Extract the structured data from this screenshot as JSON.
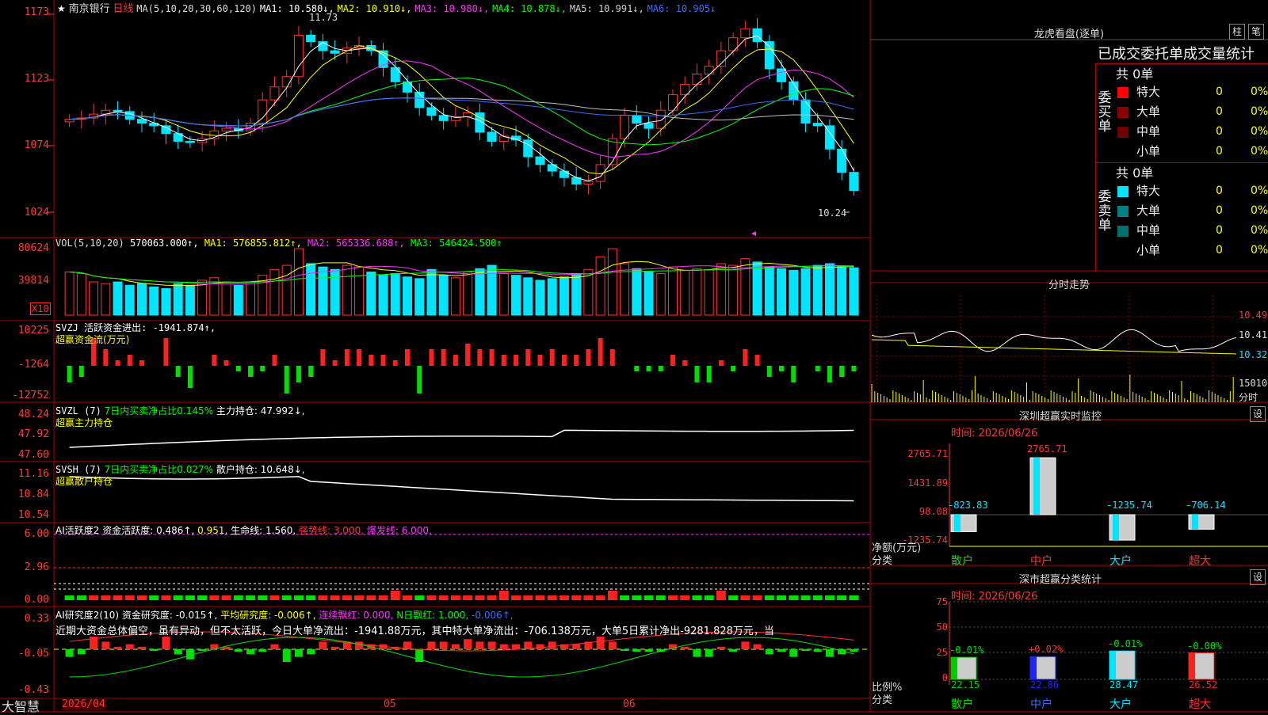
{
  "colors": {
    "up": "#ff3333",
    "down": "#00e5ff",
    "ma1": "#ffffff",
    "ma2": "#ffff00",
    "ma3": "#ff00ff",
    "ma4": "#00ff00",
    "ma5": "#c0c0c0",
    "ma6": "#3a6cff",
    "green": "#00e000",
    "yellow": "#ffff00",
    "magenta": "#ff33ff",
    "grid": "#a00000"
  },
  "header": {
    "star": "★",
    "stock_name": "南京银行",
    "period": "日线",
    "ma_label": "MA(5,10,20,30,60,120)",
    "ma1": "MA1: 10.580↓,",
    "ma2": "MA2: 10.910↓,",
    "ma3": "MA3: 10.980↓,",
    "ma4": "MA4: 10.878↓,",
    "ma5": "MA5: 10.991↓,",
    "ma6": "MA6: 10.905↓"
  },
  "main": {
    "yticks": [
      "1173",
      "1123",
      "1074",
      "1024"
    ],
    "high_label": "11.73",
    "low_label": "10.24"
  },
  "vol": {
    "label": "VOL(5,10,20)",
    "value": "570063.000↑,",
    "ma1": "MA1: 576855.812↑,",
    "ma2": "MA2: 565336.688↑,",
    "ma3": "MA3: 546424.500↑",
    "yticks": [
      "80624",
      "39814"
    ],
    "unit": "X10"
  },
  "svzj": {
    "label": "SVZJ  活跃资金进出: -1941.874↑,",
    "sub": "超赢资金流(万元)",
    "yticks": [
      "10225",
      "-1264",
      "-12752"
    ]
  },
  "svzl": {
    "label": "SVZL (7)",
    "ratio": "7日内买卖净占比0.145%",
    "main": "主力持仓: 47.992↓,",
    "sub": "超赢主力持仓",
    "yticks": [
      "48.24",
      "47.92",
      "47.60"
    ]
  },
  "svsh": {
    "label": "SVSH (7)",
    "ratio": "7日内买卖净占比0.027%",
    "main": "散户持仓: 10.648↓,",
    "sub": "超赢散户持仓",
    "yticks": [
      "11.16",
      "10.84",
      "10.54"
    ]
  },
  "ai1": {
    "label": "AI活跃度2",
    "act": "资金活跃度: 0.486↑,",
    "v2": "0.951,",
    "life": "生命线: 1.560,",
    "strong": "强势线: 3.000,",
    "burst": "爆发线: 6.000,",
    "yticks": [
      "6.00",
      "2.96",
      "0.00"
    ]
  },
  "ai2": {
    "label": "AI研究度2(10)",
    "res": "资金研究度: -0.015↑,",
    "avg": "平均研究度: -0.006↑,",
    "cont": "连续飘红: 0.000,",
    "nday": "N日飘红: 1.000,",
    "last": "-0.006↑,",
    "text": "近期大资金总体偏空，虽有异动，但不太活跃，今日大单净流出：-1941.88万元，其中特大单净流出：-706.138万元，大单5日累计净出-9281.828万元，当",
    "yticks": [
      "0.33",
      "-0.05",
      "-0.43"
    ]
  },
  "footer": {
    "brand": "大智慧",
    "date": "2026/04",
    "month5": "05",
    "month6": "06"
  },
  "right": {
    "dragon_title": "龙虎看盘(逐单)",
    "btn_zhu": "柱",
    "btn_bi": "笔",
    "ob_title": "已成交委托单成交量统计",
    "buy_label": "委买单",
    "sell_label": "委卖单",
    "buy_total": "共 0单",
    "sell_total": "共 0单",
    "buy_rows": [
      {
        "name": "特大",
        "count": "0",
        "pct": "0%",
        "color": "#ff0000"
      },
      {
        "name": "大单",
        "count": "0",
        "pct": "0%",
        "color": "#8b0000"
      },
      {
        "name": "中单",
        "count": "0",
        "pct": "0%",
        "color": "#700000"
      },
      {
        "name": "小单",
        "count": "0",
        "pct": "0%",
        "color": ""
      }
    ],
    "sell_rows": [
      {
        "name": "特大",
        "count": "0",
        "pct": "0%",
        "color": "#00e5ff"
      },
      {
        "name": "大单",
        "count": "0",
        "pct": "0%",
        "color": "#008080"
      },
      {
        "name": "中单",
        "count": "0",
        "pct": "0%",
        "color": "#007070"
      },
      {
        "name": "小单",
        "count": "0",
        "pct": "0%",
        "color": ""
      }
    ],
    "intraday_title": "分时走势",
    "intraday_yticks": [
      "10.49",
      "10.41",
      "10.32"
    ],
    "intraday_vol": "15010",
    "intraday_unit": "分时",
    "monitor_title": "深圳超赢实时监控",
    "settings": "设",
    "monitor_time": "时间: 2026/06/26",
    "monitor_yticks": [
      "2765.71",
      "1431.89",
      "98.08",
      "-1235.74"
    ],
    "monitor_axis": "净额(万元)",
    "monitor_class": "分类",
    "monitor_bars": [
      {
        "label": "散户",
        "value": "-823.83",
        "v": -823.83
      },
      {
        "label": "中户",
        "value": "2765.71",
        "v": 2765.71
      },
      {
        "label": "大户",
        "value": "-1235.74",
        "v": -1235.74
      },
      {
        "label": "超大",
        "value": "-706.14",
        "v": -706.14
      }
    ],
    "stat_title": "深市超赢分类统计",
    "stat_time": "时间: 2026/06/26",
    "stat_yticks": [
      "75",
      "50",
      "25",
      "0"
    ],
    "stat_axis": "比例%",
    "stat_class": "分类",
    "stat_bars": [
      {
        "label": "散户",
        "change": "-0.01%",
        "value": "22.15",
        "v": 22.15,
        "color": "#00cc00"
      },
      {
        "label": "中户",
        "change": "+0.02%",
        "value": "22.86",
        "v": 22.86,
        "color": "#2222ff"
      },
      {
        "label": "大户",
        "change": "-0.01%",
        "value": "28.47",
        "v": 28.47,
        "color": "#00e5ff"
      },
      {
        "label": "超大",
        "change": "-0.00%",
        "value": "26.52",
        "v": 26.52,
        "color": "#ff2222"
      }
    ]
  }
}
